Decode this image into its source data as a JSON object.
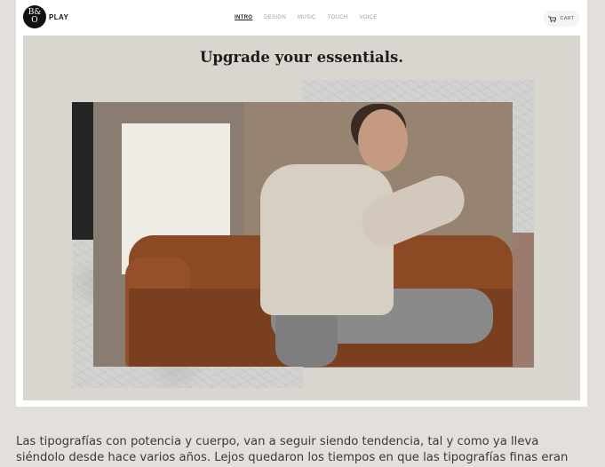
{
  "brand": {
    "logo_top": "B&",
    "logo_bottom": "O",
    "wordmark": "PLAY"
  },
  "nav": {
    "items": [
      {
        "label": "INTRO",
        "active": true
      },
      {
        "label": "DESIGN",
        "active": false
      },
      {
        "label": "MUSIC",
        "active": false
      },
      {
        "label": "TOUCH",
        "active": false
      },
      {
        "label": "VOICE",
        "active": false
      }
    ]
  },
  "cart": {
    "label": "CART",
    "icon": "cart-icon"
  },
  "hero": {
    "headline": "Upgrade your essentials."
  },
  "article": {
    "line1": "Las tipografías con potencia y cuerpo, van a seguir siendo tendencia, tal y como ya lleva",
    "line2": "siéndolo desde hace varios años. Lejos quedaron los tiempos en que las tipografías finas eran"
  },
  "colors": {
    "page_bg": "#e3e0dc",
    "hero_bg": "#d9d6cf",
    "accent_brown": "#9b7b6e",
    "dark_block": "#252525"
  }
}
